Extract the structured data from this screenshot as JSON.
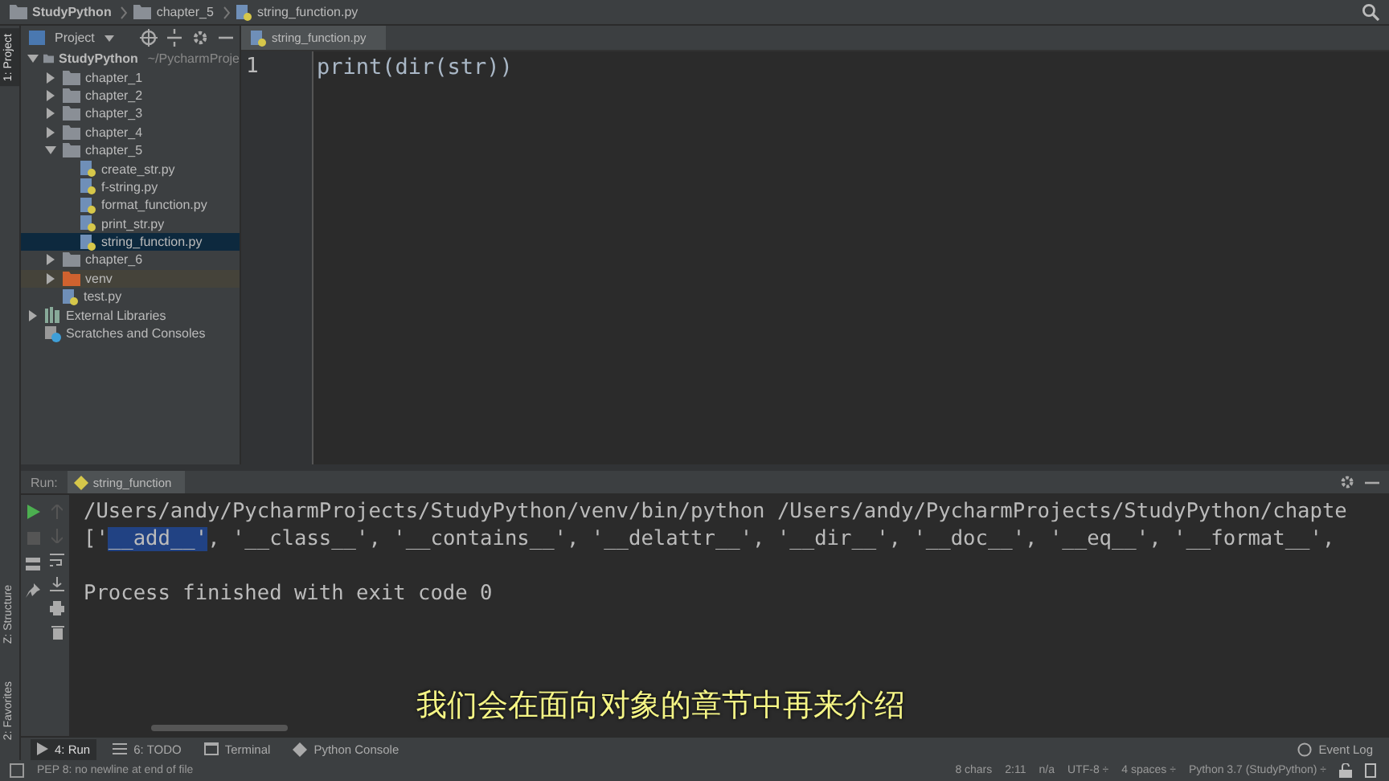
{
  "breadcrumbs": [
    {
      "label": "StudyPython",
      "kind": "folder"
    },
    {
      "label": "chapter_5",
      "kind": "folder"
    },
    {
      "label": "string_function.py",
      "kind": "file"
    }
  ],
  "left_stripe": [
    {
      "label": "1: Project",
      "selected": true
    },
    {
      "label": "Z: Structure",
      "selected": false
    },
    {
      "label": "2: Favorites",
      "selected": false
    }
  ],
  "project_panel": {
    "title": "Project",
    "tree": [
      {
        "label": "StudyPython",
        "hint": "~/PycharmProje",
        "kind": "folder",
        "expanded": true,
        "selected": false,
        "children": [
          {
            "label": "chapter_1",
            "kind": "folder",
            "expanded": false,
            "selected": false
          },
          {
            "label": "chapter_2",
            "kind": "folder",
            "expanded": false,
            "selected": false
          },
          {
            "label": "chapter_3",
            "kind": "folder",
            "expanded": false,
            "selected": false
          },
          {
            "label": "chapter_4",
            "kind": "folder",
            "expanded": false,
            "selected": false
          },
          {
            "label": "chapter_5",
            "kind": "folder",
            "expanded": true,
            "selected": false,
            "children": [
              {
                "label": "create_str.py",
                "kind": "file",
                "selected": false
              },
              {
                "label": "f-string.py",
                "kind": "file",
                "selected": false
              },
              {
                "label": "format_function.py",
                "kind": "file",
                "selected": false
              },
              {
                "label": "print_str.py",
                "kind": "file",
                "selected": false
              },
              {
                "label": "string_function.py",
                "kind": "file",
                "selected": true
              }
            ]
          },
          {
            "label": "chapter_6",
            "kind": "folder",
            "expanded": false,
            "selected": false
          },
          {
            "label": "venv",
            "kind": "venv",
            "expanded": false,
            "selected": false
          },
          {
            "label": "test.py",
            "kind": "file",
            "selected": false
          }
        ]
      },
      {
        "label": "External Libraries",
        "kind": "library",
        "expanded": false,
        "selected": false
      },
      {
        "label": "Scratches and Consoles",
        "kind": "scratches",
        "selected": false
      }
    ]
  },
  "editor": {
    "tab": "string_function.py",
    "lines": [
      {
        "number": "1",
        "code": "print(dir(str))"
      }
    ]
  },
  "run_panel": {
    "label": "Run:",
    "tab": "string_function",
    "console": [
      {
        "kind": "command",
        "text": "/Users/andy/PycharmProjects/StudyPython/venv/bin/python /Users/andy/PycharmProjects/StudyPython/chapte"
      },
      {
        "kind": "output",
        "before": "['",
        "selection": "__add__'",
        "after": ", '__class__', '__contains__', '__delattr__', '__dir__', '__doc__', '__eq__', '__format__',"
      },
      {
        "kind": "status",
        "text": "Process finished with exit code 0"
      }
    ]
  },
  "subtitle": "我们会在面向对象的章节中再来介绍",
  "tool_tabs": [
    {
      "label": "4: Run",
      "kind": "run",
      "selected": true
    },
    {
      "label": "6: TODO",
      "kind": "todo",
      "selected": false
    },
    {
      "label": "Terminal",
      "kind": "terminal",
      "selected": false
    },
    {
      "label": "Python Console",
      "kind": "python",
      "selected": false
    }
  ],
  "event_log": "Event Log",
  "status_bar": {
    "message": "PEP 8: no newline at end of file",
    "items": [
      "8 chars",
      "2:11",
      "n/a",
      "UTF-8 ÷",
      "4 spaces ÷",
      "Python 3.7 (StudyPython) ÷"
    ]
  }
}
